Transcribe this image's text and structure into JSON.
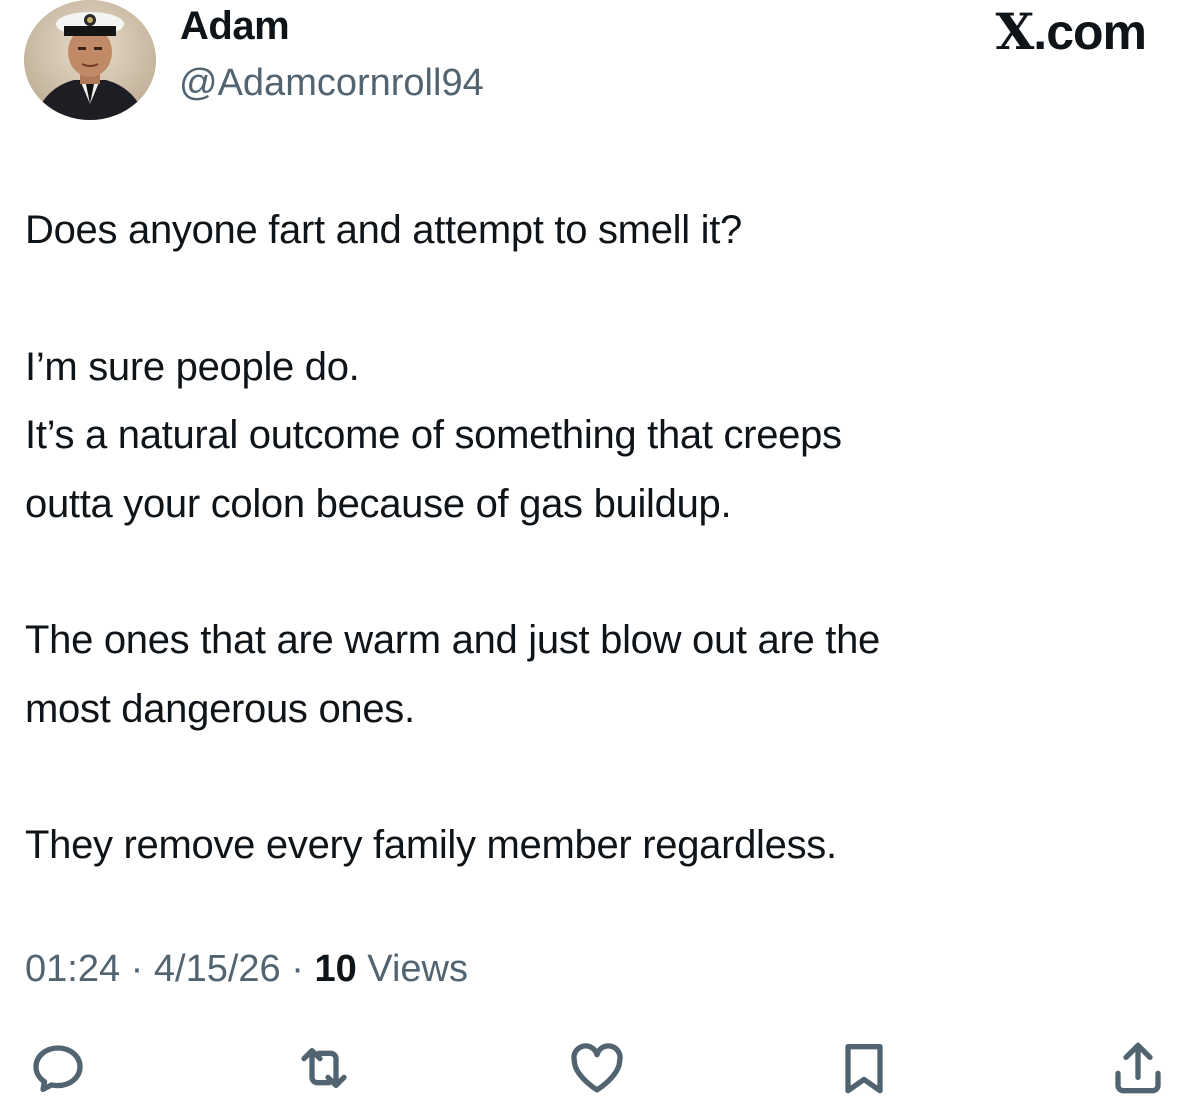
{
  "author": {
    "display_name": "Adam",
    "handle": "@Adamcornroll94"
  },
  "brand": {
    "glyph": "X",
    "suffix": ".com"
  },
  "tweet": {
    "paragraphs": [
      [
        "Does anyone fart and attempt to smell it?"
      ],
      [
        "I’m sure people do.",
        "It’s a natural outcome of something that creeps",
        "outta your colon because of gas buildup."
      ],
      [
        "The ones that are warm and just blow out are the",
        "most dangerous ones."
      ],
      [
        "They remove every family member regardless."
      ]
    ]
  },
  "meta": {
    "time": "01:24",
    "date": "4/15/26",
    "views_count": "10",
    "views_label": "Views",
    "separator": "·"
  },
  "actions": {
    "icons": [
      "reply-icon",
      "retweet-icon",
      "like-icon",
      "bookmark-icon",
      "share-icon"
    ],
    "icon_color": "#536471"
  }
}
